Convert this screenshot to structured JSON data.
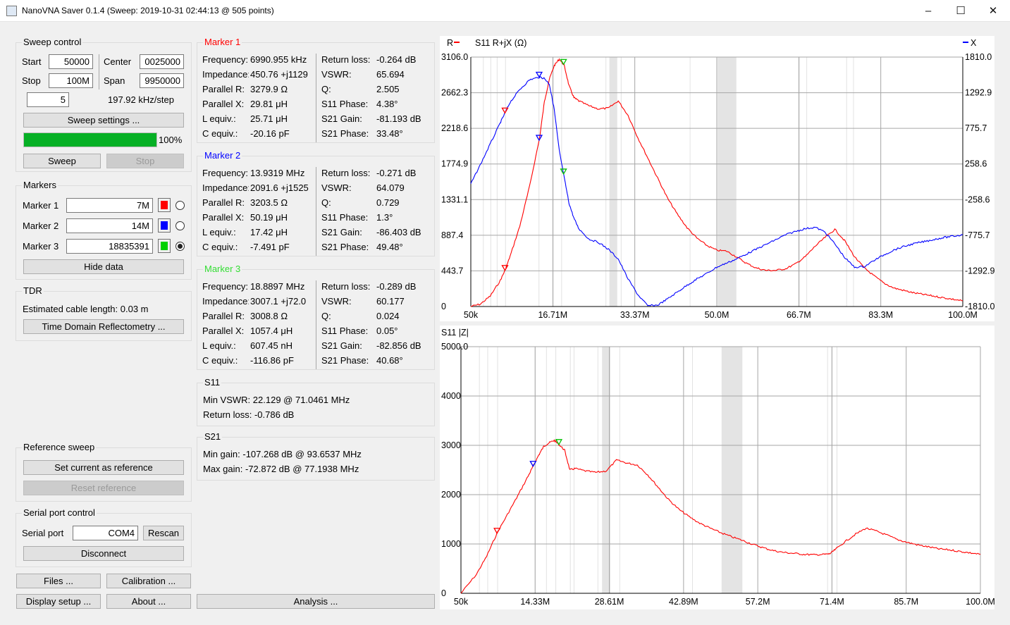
{
  "window": {
    "title": "NanoVNA Saver 0.1.4 (Sweep: 2019-10-31 02:44:13 @ 505 points)",
    "minimize_glyph": "–",
    "maximize_glyph": "☐",
    "close_glyph": "✕"
  },
  "sweep_control": {
    "title": "Sweep control",
    "start_label": "Start",
    "start_value": "50000",
    "center_label": "Center",
    "center_value": "0025000",
    "stop_label": "Stop",
    "stop_value": "100M",
    "span_label": "Span",
    "span_value": "9950000",
    "segments_value": "5",
    "step_text": "197.92 kHz/step",
    "settings_button": "Sweep settings ...",
    "progress_percent": 100,
    "progress_text": "100%",
    "sweep_button": "Sweep",
    "stop_button": "Stop"
  },
  "markers": {
    "title": "Markers",
    "rows": [
      {
        "label": "Marker 1",
        "value": "7M",
        "color": "#ff0000",
        "selected": false
      },
      {
        "label": "Marker 2",
        "value": "14M",
        "color": "#0000ff",
        "selected": false
      },
      {
        "label": "Marker 3",
        "value": "18835391",
        "color": "#00d000",
        "selected": true
      }
    ],
    "hide_button": "Hide data"
  },
  "tdr": {
    "title": "TDR",
    "cable_text": "Estimated cable length: 0.03 m",
    "tdr_button": "Time Domain Reflectometry ..."
  },
  "reference_sweep": {
    "title": "Reference sweep",
    "set_button": "Set current as reference",
    "reset_button": "Reset reference"
  },
  "serial": {
    "title": "Serial port control",
    "port_label": "Serial port",
    "port_value": "COM4",
    "rescan_button": "Rescan",
    "disconnect_button": "Disconnect"
  },
  "bottom_buttons": {
    "files": "Files ...",
    "calibration": "Calibration ...",
    "display_setup": "Display setup ...",
    "about": "About ...",
    "analysis": "Analysis ..."
  },
  "marker_details": [
    {
      "title": "Marker 1",
      "color": "#ff0000",
      "left": [
        [
          "Frequency:",
          "6990.955 kHz"
        ],
        [
          "Impedance:",
          "450.76 +j1129"
        ],
        [
          "Parallel R:",
          "3279.9 Ω"
        ],
        [
          "Parallel X:",
          "29.81 μH"
        ],
        [
          "L equiv.:",
          "25.71 μH"
        ],
        [
          "C equiv.:",
          "-20.16 pF"
        ]
      ],
      "right": [
        [
          "Return loss:",
          "-0.264 dB"
        ],
        [
          "VSWR:",
          "65.694"
        ],
        [
          "Q:",
          "2.505"
        ],
        [
          "S11 Phase:",
          "4.38°"
        ],
        [
          "S21 Gain:",
          "-81.193 dB"
        ],
        [
          "S21 Phase:",
          "33.48°"
        ]
      ]
    },
    {
      "title": "Marker 2",
      "color": "#0000ff",
      "left": [
        [
          "Frequency:",
          "13.9319 MHz"
        ],
        [
          "Impedance:",
          "2091.6 +j1525"
        ],
        [
          "Parallel R:",
          "3203.5 Ω"
        ],
        [
          "Parallel X:",
          "50.19 μH"
        ],
        [
          "L equiv.:",
          "17.42 μH"
        ],
        [
          "C equiv.:",
          "-7.491 pF"
        ]
      ],
      "right": [
        [
          "Return loss:",
          "-0.271 dB"
        ],
        [
          "VSWR:",
          "64.079"
        ],
        [
          "Q:",
          "0.729"
        ],
        [
          "S11 Phase:",
          "1.3°"
        ],
        [
          "S21 Gain:",
          "-86.403 dB"
        ],
        [
          "S21 Phase:",
          "49.48°"
        ]
      ]
    },
    {
      "title": "Marker 3",
      "color": "#33dd33",
      "left": [
        [
          "Frequency:",
          "18.8897 MHz"
        ],
        [
          "Impedance:",
          "3007.1 +j72.0"
        ],
        [
          "Parallel R:",
          "3008.8 Ω"
        ],
        [
          "Parallel X:",
          "1057.4 μH"
        ],
        [
          "L equiv.:",
          "607.45 nH"
        ],
        [
          "C equiv.:",
          "-116.86 pF"
        ]
      ],
      "right": [
        [
          "Return loss:",
          "-0.289 dB"
        ],
        [
          "VSWR:",
          "60.177"
        ],
        [
          "Q:",
          "0.024"
        ],
        [
          "S11 Phase:",
          "0.05°"
        ],
        [
          "S21 Gain:",
          "-82.856 dB"
        ],
        [
          "S21 Phase:",
          "40.68°"
        ]
      ]
    }
  ],
  "s11_summary": {
    "title": "S11",
    "min_vswr": "Min VSWR:  22.129 @ 71.0461 MHz",
    "return_loss": "Return loss: -0.786 dB"
  },
  "s21_summary": {
    "title": "S21",
    "min_gain": "Min gain:  -107.268 dB @ 93.6537 MHz",
    "max_gain": "Max gain: -72.872 dB @ 77.1938 MHz"
  },
  "chart_data": [
    {
      "type": "line",
      "title": "S11  R+jX (Ω)",
      "legend": [
        {
          "name": "R",
          "color": "#ff0000"
        },
        {
          "name": "X",
          "color": "#0000ff"
        }
      ],
      "x_ticks": [
        "50k",
        "16.71M",
        "33.37M",
        "50.0M",
        "66.7M",
        "83.3M",
        "100.0M"
      ],
      "y_left_ticks": [
        "3106.0",
        "2662.3",
        "2218.6",
        "1774.9",
        "1331.1",
        "887.4",
        "443.7",
        "0"
      ],
      "y_right_ticks": [
        "1810.0",
        "1292.9",
        "775.7",
        "258.6",
        "-258.6",
        "-775.7",
        "-1292.9",
        "-1810.0"
      ],
      "xlim": [
        0.05,
        100.0
      ],
      "ylim_left": [
        0,
        3106.0
      ],
      "ylim_right": [
        -1810.0,
        1810.0
      ],
      "series": [
        {
          "name": "R",
          "axis": "left",
          "color": "#ff0000",
          "x": [
            0.05,
            2,
            4,
            6,
            7,
            8,
            10,
            12,
            14,
            15,
            16,
            17,
            18,
            19,
            20,
            21,
            22,
            24,
            26,
            28,
            30,
            32,
            34,
            36,
            38,
            40,
            42,
            44,
            46,
            48,
            50,
            52,
            54,
            56,
            58,
            60,
            62,
            64,
            66,
            68,
            70,
            72,
            74,
            76,
            78,
            80,
            82,
            84,
            86,
            88,
            90,
            92,
            94,
            96,
            98,
            100
          ],
          "y": [
            0,
            30,
            130,
            320,
            451,
            620,
            1000,
            1500,
            2091,
            2550,
            2830,
            3000,
            3080,
            3007,
            2750,
            2600,
            2560,
            2500,
            2460,
            2470,
            2560,
            2380,
            2100,
            1850,
            1600,
            1350,
            1150,
            980,
            850,
            760,
            700,
            690,
            620,
            540,
            480,
            450,
            450,
            470,
            530,
            620,
            750,
            860,
            960,
            820,
            620,
            480,
            380,
            290,
            230,
            200,
            170,
            150,
            130,
            110,
            90,
            70
          ]
        },
        {
          "name": "X",
          "axis": "right",
          "color": "#0000ff",
          "x": [
            0.05,
            2,
            4,
            6,
            7,
            8,
            10,
            12,
            14,
            15,
            16,
            17,
            18,
            19,
            20,
            21,
            22,
            24,
            26,
            28,
            30,
            32,
            34,
            36,
            38,
            40,
            42,
            44,
            46,
            48,
            50,
            52,
            54,
            56,
            58,
            60,
            62,
            64,
            66,
            68,
            70,
            72,
            74,
            76,
            78,
            80,
            82,
            84,
            86,
            88,
            90,
            92,
            94,
            96,
            98,
            100
          ],
          "y": [
            -30,
            250,
            550,
            850,
            1000,
            1150,
            1340,
            1480,
            1520,
            1500,
            1420,
            1050,
            460,
            70,
            -310,
            -530,
            -680,
            -830,
            -880,
            -980,
            -1120,
            -1410,
            -1640,
            -1800,
            -1790,
            -1700,
            -1600,
            -1500,
            -1410,
            -1330,
            -1240,
            -1180,
            -1120,
            -1050,
            -980,
            -910,
            -840,
            -770,
            -720,
            -680,
            -660,
            -730,
            -900,
            -1100,
            -1240,
            -1230,
            -1140,
            -1060,
            -990,
            -940,
            -900,
            -870,
            -840,
            -810,
            -790,
            -770
          ]
        }
      ]
    },
    {
      "type": "line",
      "title": "S11 |Z|",
      "x_ticks": [
        "50k",
        "14.33M",
        "28.61M",
        "42.89M",
        "57.2M",
        "71.4M",
        "85.7M",
        "100.0M"
      ],
      "y_ticks": [
        "5000.0",
        "4000",
        "3000",
        "2000",
        "1000",
        "0"
      ],
      "xlim": [
        0.05,
        100.0
      ],
      "ylim": [
        0,
        5000
      ],
      "series": [
        {
          "name": "|Z|",
          "color": "#ff0000",
          "x": [
            0.05,
            3,
            5,
            7,
            9,
            11,
            13,
            14,
            15,
            16,
            17,
            18,
            19,
            20,
            21,
            22,
            24,
            26,
            28,
            30,
            32,
            34,
            36,
            38,
            40,
            42,
            44,
            46,
            48,
            50,
            52,
            54,
            56,
            58,
            60,
            62,
            64,
            66,
            68,
            70,
            71,
            72,
            74,
            76,
            78,
            80,
            82,
            84,
            86,
            88,
            90,
            92,
            94,
            96,
            98,
            100
          ],
          "y": [
            0,
            380,
            750,
            1220,
            1600,
            1980,
            2380,
            2590,
            2800,
            2980,
            3050,
            3100,
            3007,
            2900,
            2500,
            2530,
            2480,
            2450,
            2480,
            2700,
            2640,
            2600,
            2400,
            2150,
            1900,
            1700,
            1550,
            1420,
            1320,
            1230,
            1150,
            1080,
            1000,
            930,
            870,
            830,
            810,
            790,
            780,
            790,
            800,
            880,
            1050,
            1200,
            1320,
            1260,
            1180,
            1090,
            1030,
            980,
            940,
            900,
            880,
            850,
            820,
            790
          ]
        }
      ]
    }
  ]
}
